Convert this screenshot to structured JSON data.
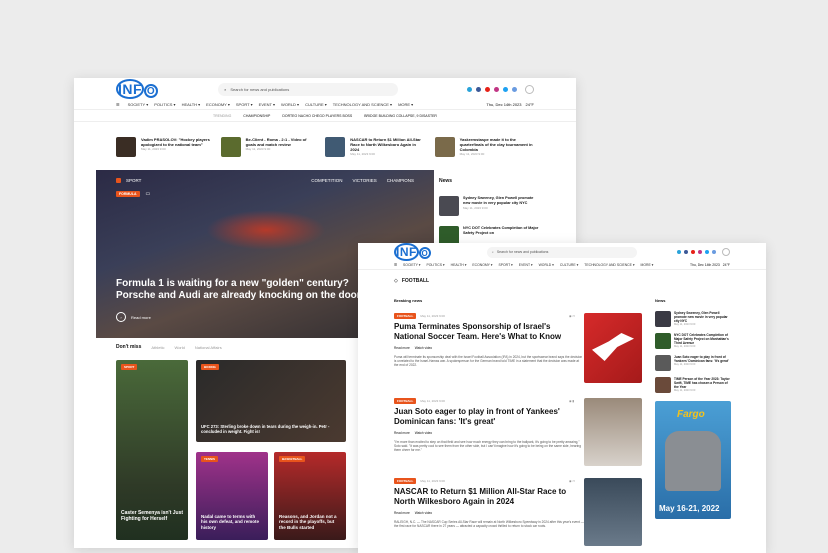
{
  "back": {
    "logo": "INF",
    "logo_o": "O",
    "search_placeholder": "Search for news and publications",
    "nav": [
      "SOCIETY ▾",
      "POLITICS ▾",
      "HEALTH ▾",
      "ECONOMY ▾",
      "SPORT ▾",
      "EVENT ▾",
      "WORLD ▾",
      "CULTURE ▾",
      "TECHNOLOGY AND SCIENCE ▾",
      "MORE ▾"
    ],
    "date": "Thu, Dec 14th 2023",
    "weather": "24°F",
    "trending_label": "TRENDING",
    "trending": [
      "CHAMPIONSHIP",
      "DORTEO NACHO CHEGO PLAYERS BOSS",
      "BRIDGE BUILDING COLLAPSE, 9 DISASTER"
    ],
    "ticker": [
      {
        "title": "Vadim PRASOLOV: \"Hockey players apologized to the national team\"",
        "meta": "May 11, 2023 9:00"
      },
      {
        "title": "Be-Client - Roma - 2:1 - Video of goals and match review",
        "meta": "May 11, 2023 9:00"
      },
      {
        "title": "NASCAR to Return $1 Million All-Star Race to North Wilkesboro Again in 2024",
        "meta": "May 11, 2023 9:00"
      },
      {
        "title": "Yaskremstaspe made it to the quarterfinals of the clay tournament in Colombia",
        "meta": "May 11, 2023 9:00"
      }
    ],
    "hero": {
      "section": "SPORT",
      "tabs": [
        "COMPETITION",
        "VICTORIES",
        "CHAMPIONS"
      ],
      "badge": "FORMULA",
      "headline": "Formula 1 is waiting for a new \"golden\" century? Porsche and Audi are already knocking on the door",
      "read_more": "Read more"
    },
    "news_title": "News",
    "news": [
      {
        "title": "Sydney Sweeney, Glen Powell promote new movie in very popular city NYC",
        "meta": "May 11, 2023 9:00"
      },
      {
        "title": "NYC DOT Celebrates Completion of Major Safety Project on",
        "meta": ""
      }
    ],
    "dont_miss": {
      "title": "Don't miss",
      "tabs": [
        "Athletic",
        "World",
        "National Affairs"
      ],
      "cards": [
        {
          "badge": "SPORT",
          "caption": "Caster Semenya isn't Just Fighting for Herself"
        },
        {
          "badge": "BOXING",
          "caption": "UFC 273: Sterling broke down in tears during the weigh-in. Petr - concluded in weight. Fight is!"
        },
        {
          "badge": "TENNIS",
          "caption": "Nadal came to terms with his own defeat, and remote history"
        },
        {
          "badge": "BASKETBALL",
          "caption": "Reasons, and Jordan not a record in the playoffs, but the Bulls started"
        }
      ]
    }
  },
  "front": {
    "logo": "INF",
    "logo_o": "O",
    "search_placeholder": "Search for news and publications",
    "nav": [
      "SOCIETY ▾",
      "POLITICS ▾",
      "HEALTH ▾",
      "ECONOMY ▾",
      "SPORT ▾",
      "EVENT ▾",
      "WORLD ▾",
      "CULTURE ▾",
      "TECHNOLOGY AND SCIENCE ▾",
      "MORE ▾"
    ],
    "date": "Thu, Dec 14th 2023",
    "weather": "24°F",
    "page_title": "FOOTBALL",
    "breaking_title": "Breaking news",
    "articles": [
      {
        "badge": "FOOTBALL",
        "meta": "May 11, 2023 9:00",
        "title": "Puma Terminates Sponsorship of Israel's National Soccer Team. Here's What to Know",
        "actions": [
          "Read more",
          "Watch video"
        ],
        "text": "Puma will terminate its sponsorship deal with the Israel Football Association (IFA) in 2024, but the sportswear brand says the decision is unrelated to the Israel-Hamas war. A spokesperson for the German brand told TIME in a statement that the decision was made at the end of 2022."
      },
      {
        "badge": "FOOTBALL",
        "meta": "May 11, 2023 9:00",
        "title": "Juan Soto eager to play in front of Yankees' Dominican fans: 'It's great'",
        "actions": [
          "Read more",
          "Watch video"
        ],
        "text": "\"I'm more than excited to step on that field and see how much energy they can bring to the ballpark, it's going to be pretty amazing,\" Soto said. \"It was pretty cool to see them from the other side, but I can't imagine how it's going to be being on the same side, hearing them cheer for me.\""
      },
      {
        "badge": "FOOTBALL",
        "meta": "May 11, 2023 9:00",
        "title": "NASCAR to Return $1 Million All-Star Race to North Wilkesboro Again in 2024",
        "actions": [
          "Read more",
          "Watch video"
        ],
        "text": "RALEIGH, N.C. — The NASCAR Cup Series All-Star Race will remain at North Wilkesboro Speedway in 2024 after this year's event — the first race for NASCAR there in 27 years — attracted a capacity crowd thrilled to return to stock car roots."
      }
    ],
    "news_title": "News",
    "news": [
      {
        "title": "Sydney Sweeney, Glen Powell promote new movie in very popular city NYC",
        "meta": "May 11, 2023 9:00"
      },
      {
        "title": "NYC DOT Celebrates Completion of Major Safety Project on Manhattan's Third Avenue",
        "meta": "May 11, 2023 9:00"
      },
      {
        "title": "Juan Soto eager to play in front of Yankees' Dominican fans: 'It's great'",
        "meta": "May 11, 2023 9:00"
      },
      {
        "title": "TIME Person of the Year 2023: Taylor Swift, TIME has chosen a Person of the Year",
        "meta": "May 11, 2023 9:00"
      }
    ],
    "ad": {
      "brand": "Fargo",
      "dates": "May 16-21, 2022"
    }
  },
  "colors": {
    "accent": "#e8541c",
    "brand": "#1b6fd1"
  }
}
